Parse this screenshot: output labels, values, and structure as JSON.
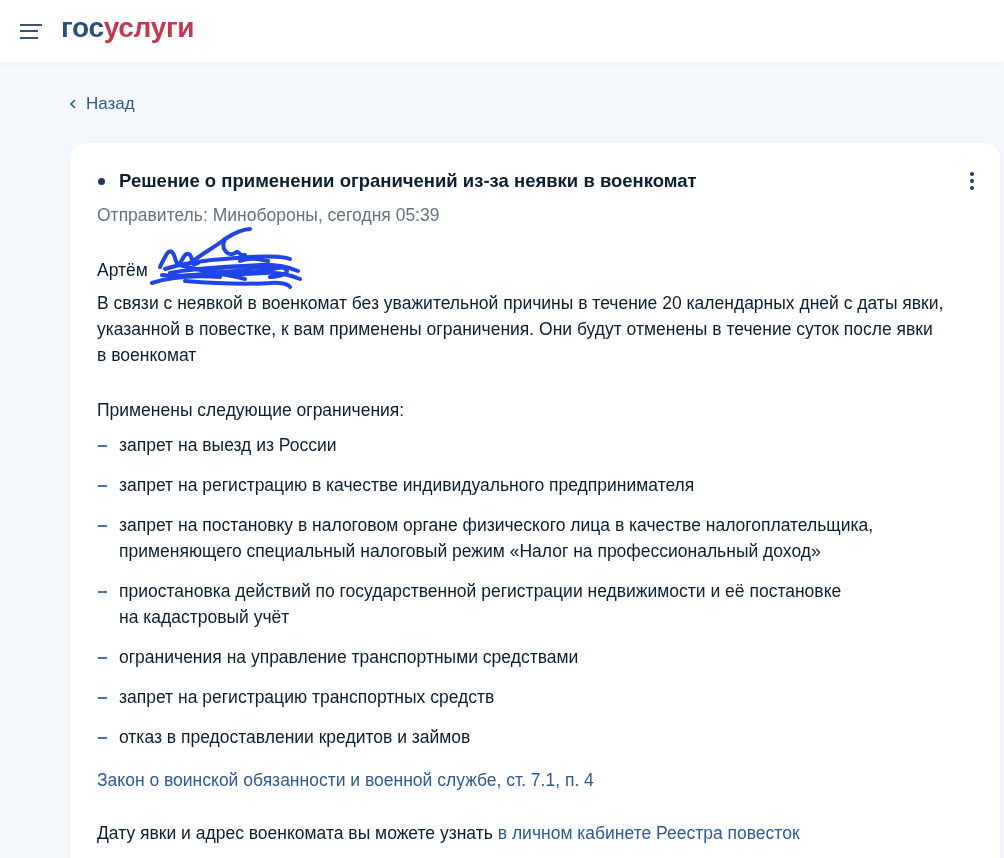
{
  "header": {
    "logo": {
      "prefix": "гос",
      "suffix": "услуги"
    }
  },
  "back_link": "Назад",
  "message": {
    "unread": true,
    "title": "Решение о применении ограничений из-за неявки в военкомат",
    "sender": "Отправитель: Минобороны, сегодня 05:39",
    "recipient": "Артём",
    "intro": "В связи с неявкой в военкомат без уважительной причины в течение 20 календарных дней с даты явки, указанной в повестке, к вам применены ограничения. Они будут отменены в течение суток после явки в военкомат",
    "restrictions_heading": "Применены следующие ограничения:",
    "restrictions": [
      "запрет на выезд из России",
      "запрет на регистрацию в качестве индивидуального предпринимателя",
      "запрет на постановку в налоговом органе физического лица в качестве налогоплательщика, применяющего специальный налоговый режим «Налог на профессиональный доход»",
      "приостановка действий по государственной регистрации недвижимости и её постановке на кадастровый учёт",
      "ограничения на управление транспортными средствами",
      "запрет на регистрацию транспортных средств",
      "отказ в предоставлении кредитов и займов"
    ],
    "law_link": "Закон о воинской обязанности и военной службе, ст. 7.1, п. 4",
    "footer": {
      "text": "Дату явки и адрес военкомата вы можете узнать",
      "link": "в личном кабинете Реестра повесток"
    }
  }
}
